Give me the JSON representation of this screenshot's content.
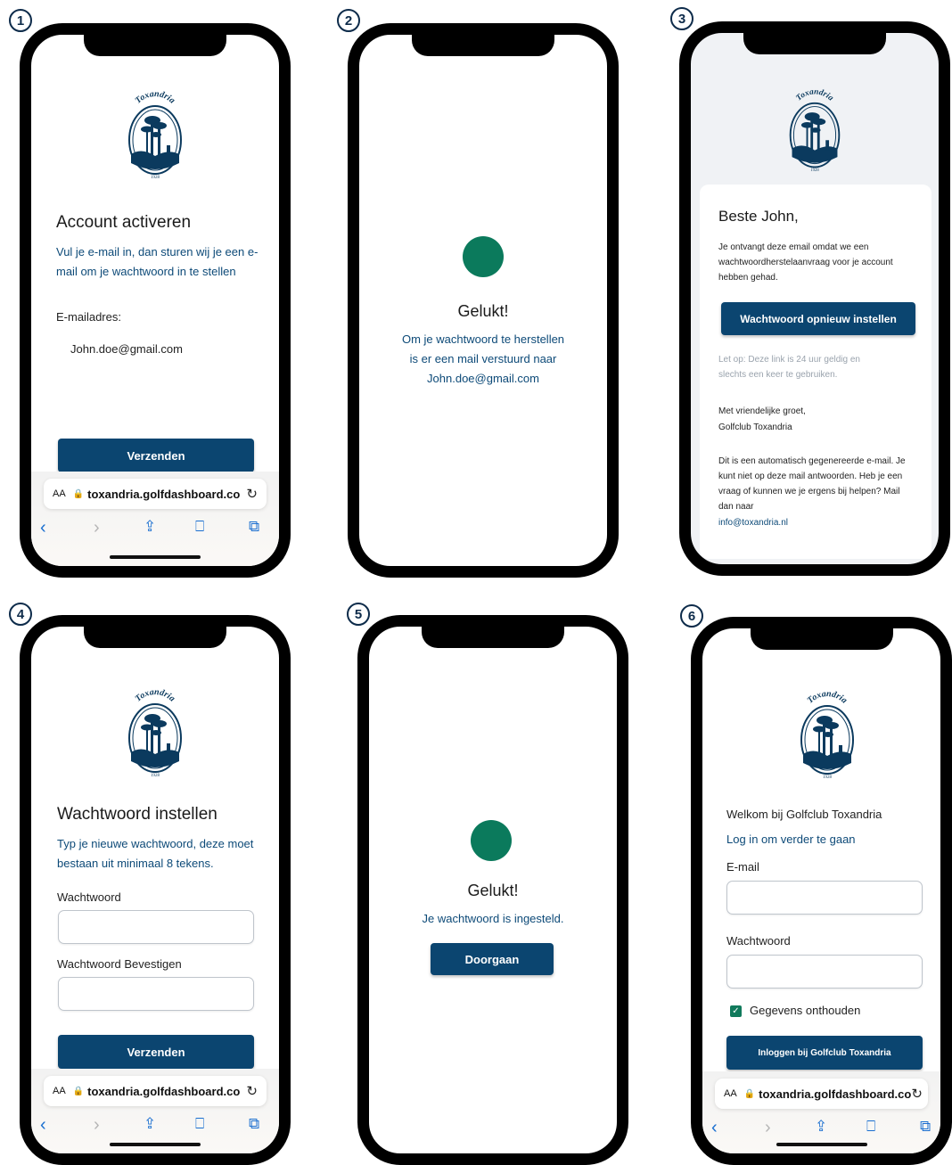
{
  "colors": {
    "primary": "#0b4570",
    "success": "#0b7a5c",
    "link_blue": "#0d4a78"
  },
  "logo": {
    "name": "Toxandria",
    "year": "1928"
  },
  "safari": {
    "aa": "AA",
    "url": "toxandria.golfdashboard.co",
    "icons": [
      "back-icon",
      "forward-icon",
      "share-icon",
      "bookmarks-icon",
      "tabs-icon"
    ]
  },
  "steps": {
    "s1": {
      "number": "1",
      "title": "Account activeren",
      "description": "Vul je e-mail in, dan sturen wij je een e-mail om je wachtwoord in te stellen",
      "email_label": "E-mailadres:",
      "email_value": "John.doe@gmail.com",
      "button": "Verzenden"
    },
    "s2": {
      "number": "2",
      "title": "Gelukt!",
      "message_line1": "Om je wachtwoord te herstellen",
      "message_line2": "is er een mail verstuurd naar",
      "message_line3": "John.doe@gmail.com"
    },
    "s3": {
      "number": "3",
      "greeting": "Beste John,",
      "body": "Je ontvangt deze email omdat we een wachtwoordherstelaanvraag voor je account hebben gehad.",
      "button": "Wachtwoord opnieuw instellen",
      "note": "Let op: Deze link is 24 uur geldig en slechts een keer te gebruiken.",
      "closing_line1": "Met vriendelijke groet,",
      "closing_line2": "Golfclub Toxandria",
      "footer": "Dit is een automatisch gegenereerde e-mail. Je kunt niet op deze mail antwoorden. Heb je een vraag of kunnen we je ergens bij helpen? Mail dan naar",
      "footer_link": "info@toxandria.nl"
    },
    "s4": {
      "number": "4",
      "title": "Wachtwoord instellen",
      "description": "Typ je nieuwe wachtwoord, deze moet bestaan uit minimaal 8 tekens.",
      "password_label": "Wachtwoord",
      "confirm_label": "Wachtwoord Bevestigen",
      "button": "Verzenden"
    },
    "s5": {
      "number": "5",
      "title": "Gelukt!",
      "message": "Je wachtwoord is ingesteld.",
      "button": "Doorgaan"
    },
    "s6": {
      "number": "6",
      "welcome": "Welkom bij Golfclub Toxandria",
      "subtitle": "Log in om verder te gaan",
      "email_label": "E-mail",
      "password_label": "Wachtwoord",
      "remember_label": "Gegevens onthouden",
      "remember_checked": true,
      "button": "Inloggen bij Golfclub Toxandria"
    }
  }
}
